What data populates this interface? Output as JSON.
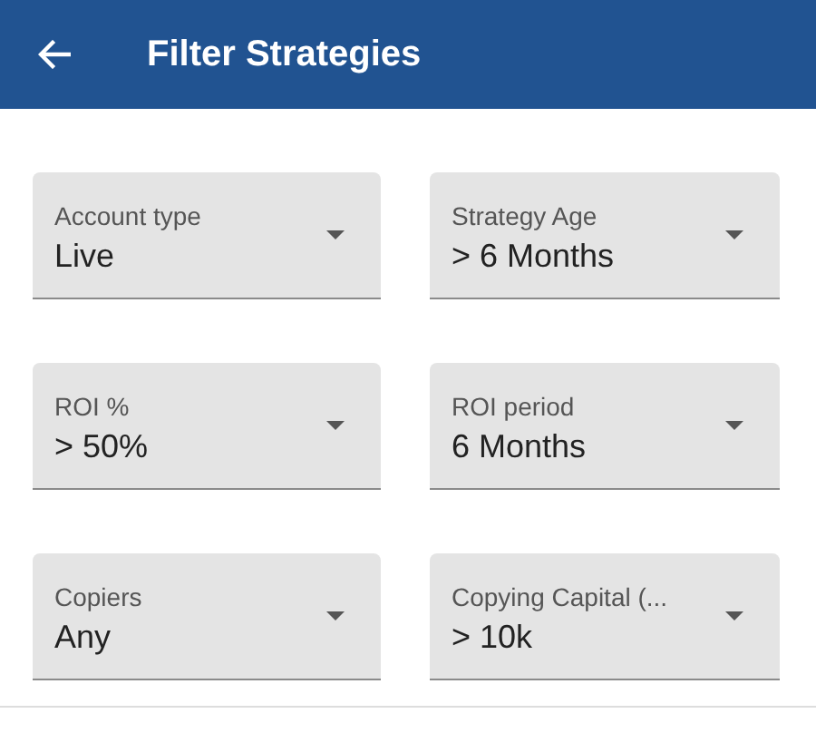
{
  "header": {
    "title": "Filter Strategies"
  },
  "filters": [
    {
      "label": "Account type",
      "value": "Live"
    },
    {
      "label": "Strategy Age",
      "value": "> 6 Months"
    },
    {
      "label": "ROI %",
      "value": "> 50%"
    },
    {
      "label": "ROI period",
      "value": "6 Months"
    },
    {
      "label": "Copiers",
      "value": "Any"
    },
    {
      "label": "Copying Capital (...",
      "value": "> 10k"
    }
  ]
}
